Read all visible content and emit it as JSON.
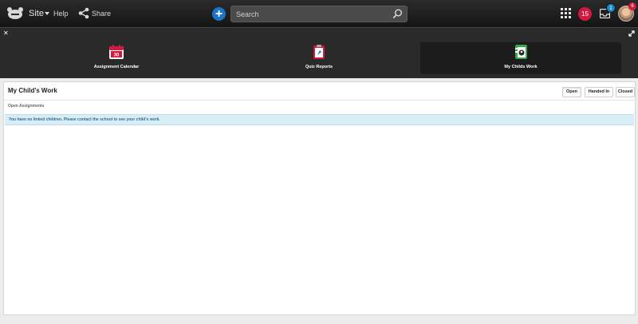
{
  "topbar": {
    "site_label": "Site",
    "help_label": "Help",
    "share_label": "Share",
    "search_placeholder": "Search",
    "notification_count": "15",
    "inbox_count": "1",
    "avatar_badge_count": "6"
  },
  "app_strip": {
    "tiles": [
      {
        "label": "Assignment Calendar",
        "icon": "calendar-icon",
        "icon_text": "30",
        "color": "#d21a3f"
      },
      {
        "label": "Quiz Reports",
        "icon": "clipboard-icon",
        "color": "#d21a3f"
      },
      {
        "label": "My Childs Work",
        "icon": "child-work-icon",
        "color": "#3aa648",
        "active": true
      }
    ]
  },
  "panel": {
    "title": "My Child's Work",
    "filters": [
      "Open",
      "Handed In",
      "Closed"
    ],
    "active_filter": "Open",
    "section_label": "Open Assignments",
    "alert_text": "You have no linked children. Please contact the school to see your child's work."
  },
  "colors": {
    "accent_blue": "#1b74c4",
    "alert_bg": "#d9edf7",
    "notification_red": "#d21a3f"
  }
}
